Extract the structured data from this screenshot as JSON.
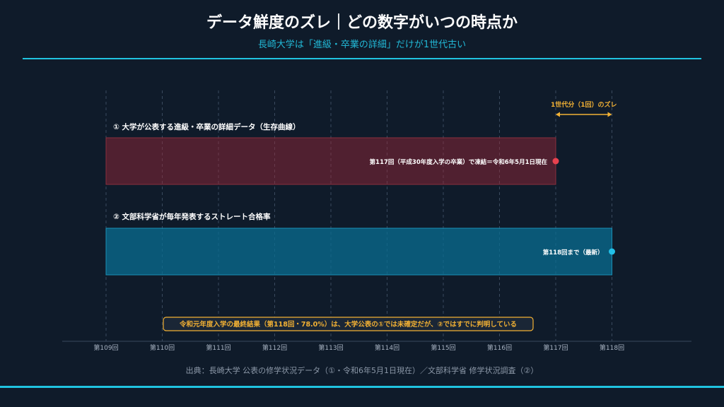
{
  "header": {
    "title": "データ鮮度のズレ｜どの数字がいつの時点か",
    "subtitle": "長崎大学は「進級・卒業の詳細」だけが1世代古い"
  },
  "footer": {
    "source": "出典：長崎大学 公表の修学状況データ（①・令和6年5月1日現在）／文部科学省 修学状況調査（②）"
  },
  "chart_data": {
    "type": "bar",
    "orientation": "horizontal-timeline",
    "categories": [
      "第109回",
      "第110回",
      "第111回",
      "第112回",
      "第113回",
      "第114回",
      "第115回",
      "第116回",
      "第117回",
      "第118回"
    ],
    "series": [
      {
        "name": "① 大学が公表する進級・卒業の詳細データ（生存曲線）",
        "start": "第109回",
        "end": "第117回",
        "end_label": "第117回（平成30年度入学の卒業）で凍結＝令和6年5月1日現在",
        "color": "#e8424f"
      },
      {
        "name": "② 文部科学省が毎年発表するストレート合格率",
        "start": "第109回",
        "end": "第118回",
        "end_label": "第118回まで（最新）",
        "color": "#22c0e8"
      }
    ],
    "annotations": {
      "gap_label": "1世代分（1回）のズレ",
      "gap_from": "第117回",
      "gap_to": "第118回",
      "note": "令和元年度入学の最終結果（第118回・78.0%）は、大学公表の①では未確定だが、②ではすでに判明している"
    },
    "grid": true,
    "accent_color": "#f2b134"
  }
}
